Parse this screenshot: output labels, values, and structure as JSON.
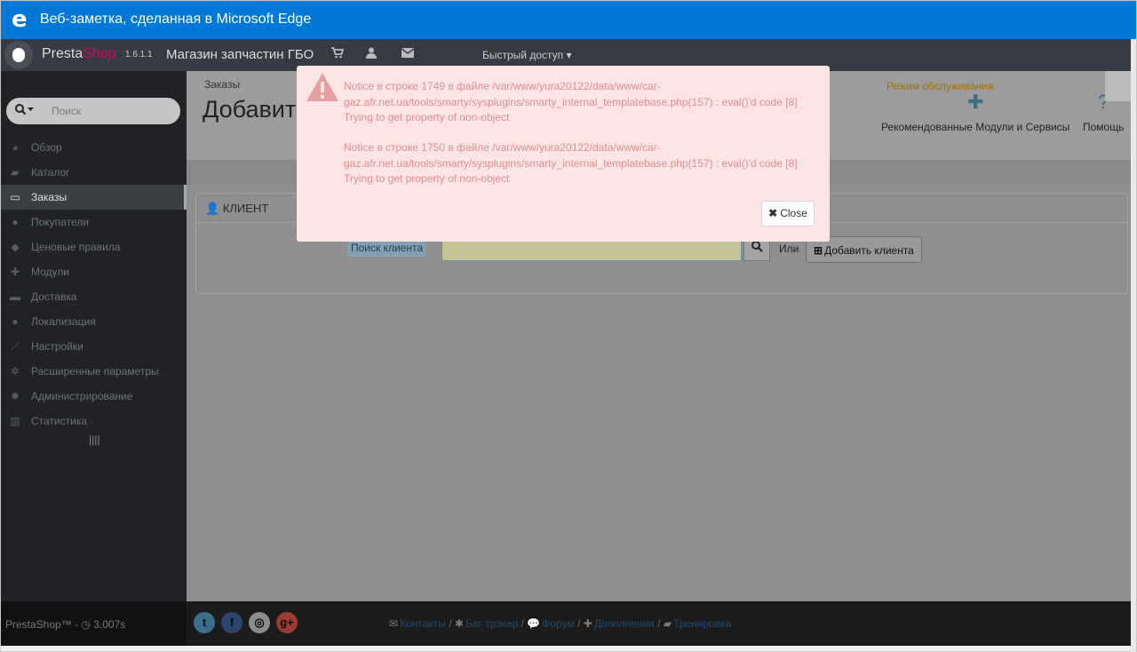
{
  "window": {
    "title": "Веб-заметка, сделанная в Microsoft Edge"
  },
  "header": {
    "brand_presta": "Presta",
    "brand_shop": "Shop",
    "version": "1.6.1.1",
    "store_name": "Магазин запчастин ГБО",
    "quick_access": "Быстрый доступ"
  },
  "sidebar": {
    "search_placeholder": "Поиск",
    "items": [
      {
        "label": "Обзор",
        "icon": "dashboard-icon"
      },
      {
        "label": "Каталог",
        "icon": "book-icon"
      },
      {
        "label": "Заказы",
        "icon": "credit-card-icon",
        "active": true
      },
      {
        "label": "Покупатели",
        "icon": "users-icon"
      },
      {
        "label": "Ценовые правила",
        "icon": "tags-icon"
      },
      {
        "label": "Модули",
        "icon": "puzzle-icon"
      },
      {
        "label": "Доставка",
        "icon": "truck-icon"
      },
      {
        "label": "Локализация",
        "icon": "globe-icon"
      },
      {
        "label": "Настройки",
        "icon": "wrench-icon"
      },
      {
        "label": "Расширенные параметры",
        "icon": "cogs-icon"
      },
      {
        "label": "Администрирование",
        "icon": "cog-icon"
      },
      {
        "label": "Статистика",
        "icon": "bar-chart-icon"
      }
    ]
  },
  "content": {
    "breadcrumb": "Заказы",
    "page_title": "Добавит",
    "maintenance": "Режим обслуживания",
    "toolbar": {
      "modules": "Рекомендованные Модули и Сервисы",
      "help": "Помощь"
    },
    "panel": {
      "title": "КЛИЕНТ",
      "search_label": "Поиск клиента",
      "search_value": "",
      "or": "Или",
      "add_client": "Добавить клиента"
    }
  },
  "alert": {
    "notice1": "Notice в строке 1749 в файле /var/www/yura20122/data/www/car-gaz.afr.net.ua/tools/smarty/sysplugins/smarty_internal_templatebase.php(157) : eval()'d code [8] Trying to get property of non-object",
    "notice2": "Notice в строке 1750 в файле /var/www/yura20122/data/www/car-gaz.afr.net.ua/tools/smarty/sysplugins/smarty_internal_templatebase.php(157) : eval()'d code [8] Trying to get property of non-object",
    "close_label": "Close"
  },
  "footer": {
    "brand": "PrestaShop™ -",
    "time": "3.007s",
    "links": [
      "Контакты",
      "Баг трэкер",
      "Форум",
      "Дополнения",
      "Тренировка"
    ],
    "social_colors": {
      "twitter": "#3a6f8e",
      "facebook": "#2c4470",
      "github": "#8b8b8b",
      "google": "#9c3b30"
    }
  }
}
